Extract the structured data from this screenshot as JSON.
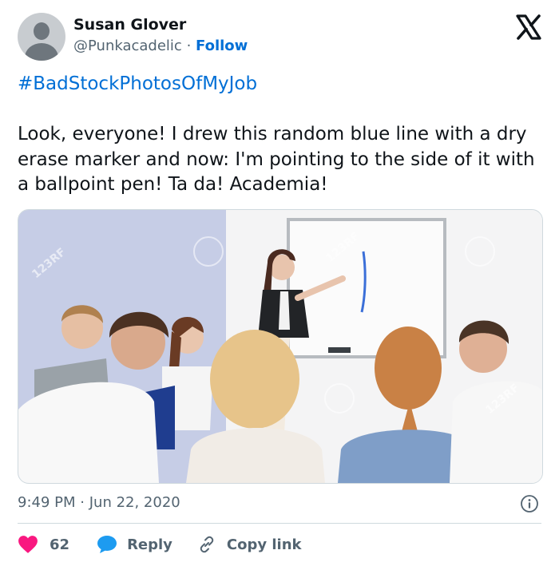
{
  "author": {
    "name": "Susan Glover",
    "handle": "@Punkacadelic",
    "separator": "·",
    "follow_label": "Follow"
  },
  "platform_icon": "x-logo-icon",
  "tweet": {
    "hashtag": "#BadStockPhotosOfMyJob",
    "text": "Look, everyone! I drew this random blue line with a dry erase marker and now: I'm pointing to the side of it with a ballpoint pen! Ta da! Academia!"
  },
  "media": {
    "watermark": "123RF"
  },
  "meta": {
    "time": "9:49 PM",
    "separator": "·",
    "date": "Jun 22, 2020",
    "info_icon": "info-icon"
  },
  "actions": {
    "like_count": "62",
    "reply_label": "Reply",
    "copy_link_label": "Copy link"
  },
  "colors": {
    "link": "#006fd6",
    "like": "#f91880",
    "reply": "#1d9bf0",
    "secondary_text": "#536471"
  }
}
